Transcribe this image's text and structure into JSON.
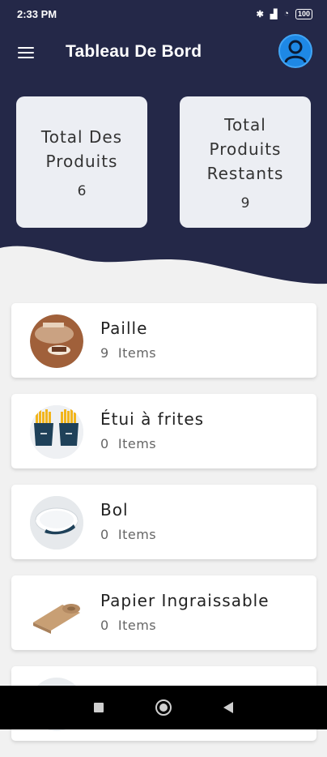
{
  "status": {
    "time": "2:33 PM",
    "battery": "100"
  },
  "header": {
    "title": "Tableau De Bord"
  },
  "stats": [
    {
      "label": "Total Des\nProduits",
      "value": "6"
    },
    {
      "label": "Total\nProduits\nRestants",
      "value": "9"
    }
  ],
  "products": [
    {
      "name": "Paille",
      "count": "9",
      "unit": "Items"
    },
    {
      "name": "Étui à frites",
      "count": "0",
      "unit": "Items"
    },
    {
      "name": "Bol",
      "count": "0",
      "unit": "Items"
    },
    {
      "name": "Papier Ingraissable",
      "count": "0",
      "unit": "Items"
    }
  ],
  "colors": {
    "header": "#242848",
    "background": "#f1f1f1",
    "card": "#eceef3",
    "avatar": "#1e88e5"
  }
}
